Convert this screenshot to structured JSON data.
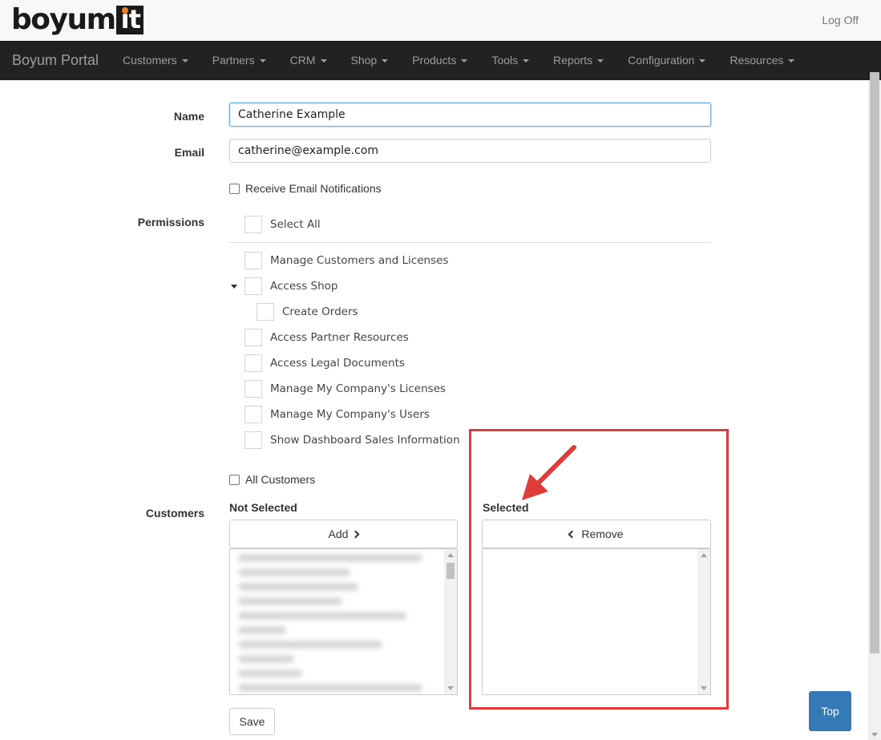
{
  "header": {
    "logo_text": "boyum",
    "logo_badge": "it",
    "logoff_label": "Log Off"
  },
  "navbar": {
    "brand": "Boyum Portal",
    "items": [
      {
        "label": "Customers"
      },
      {
        "label": "Partners"
      },
      {
        "label": "CRM"
      },
      {
        "label": "Shop"
      },
      {
        "label": "Products"
      },
      {
        "label": "Tools"
      },
      {
        "label": "Reports"
      },
      {
        "label": "Configuration"
      },
      {
        "label": "Resources"
      }
    ]
  },
  "form": {
    "name_label": "Name",
    "name_value": "Catherine Example",
    "email_label": "Email",
    "email_value": "catherine@example.com",
    "receive_notifications_label": "Receive Email Notifications",
    "permissions_label": "Permissions",
    "select_all_label": "Select All",
    "permissions": [
      {
        "label": "Manage Customers and Licenses"
      },
      {
        "label": "Access Shop"
      },
      {
        "label": "Create Orders"
      },
      {
        "label": "Access Partner Resources"
      },
      {
        "label": "Access Legal Documents"
      },
      {
        "label": "Manage My Company's Licenses"
      },
      {
        "label": "Manage My Company's Users"
      },
      {
        "label": "Show Dashboard Sales Information"
      }
    ],
    "all_customers_label": "All Customers",
    "customers_label": "Customers",
    "not_selected_title": "Not Selected",
    "selected_title": "Selected",
    "add_button": "Add",
    "remove_button": "Remove",
    "save_button": "Save",
    "top_button": "Top"
  },
  "colors": {
    "navbar_bg": "#222222",
    "highlight": "#e03c3c",
    "top_button": "#337ab7",
    "logo_accent": "#f08020"
  }
}
